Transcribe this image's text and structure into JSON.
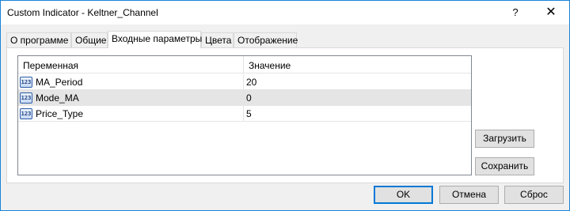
{
  "window": {
    "title": "Custom Indicator - Keltner_Channel",
    "help_label": "?",
    "close_label": "✕"
  },
  "tabs": [
    {
      "label": "О программе"
    },
    {
      "label": "Общие"
    },
    {
      "label": "Входные параметры"
    },
    {
      "label": "Цвета"
    },
    {
      "label": "Отображение"
    }
  ],
  "grid": {
    "col_variable": "Переменная",
    "col_value": "Значение",
    "rows": [
      {
        "icon": "123-icon",
        "icon_text": "123",
        "name": "MA_Period",
        "value": "20"
      },
      {
        "icon": "123-icon",
        "icon_text": "123",
        "name": "Mode_MA",
        "value": "0"
      },
      {
        "icon": "123-icon",
        "icon_text": "123",
        "name": "Price_Type",
        "value": "5"
      }
    ]
  },
  "side_buttons": {
    "load": "Загрузить",
    "save": "Сохранить"
  },
  "footer": {
    "ok": "OK",
    "cancel": "Отмена",
    "reset": "Сброс"
  }
}
